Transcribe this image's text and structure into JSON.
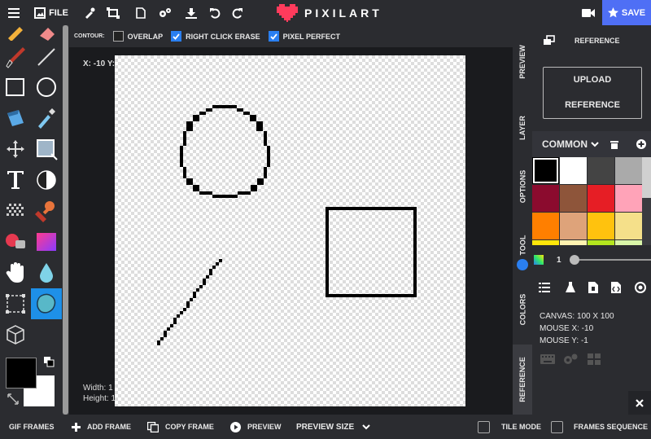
{
  "topbar": {
    "file_label": "FILE",
    "brand_name": "PIXILART",
    "save_label": "SAVE",
    "brand_color": "#ff3b5c",
    "save_color": "#4f6ff5"
  },
  "options": {
    "contour_label": "CONTOUR:",
    "overlap_label": "OVERLAP",
    "overlap_checked": false,
    "right_click_erase_label": "RIGHT CLICK ERASE",
    "right_click_erase_checked": true,
    "pixel_perfect_label": "PIXEL PERFECT",
    "pixel_perfect_checked": true
  },
  "workspace": {
    "coord_readout": "X: -10 Y:",
    "width_label": "Width: 1",
    "height_label": "Height: 1"
  },
  "side_tabs": [
    "PREVIEW",
    "LAYER",
    "OPTIONS",
    "TOOL",
    "COLORS",
    "REFERENCE"
  ],
  "active_side_tab": "REFERENCE",
  "reference": {
    "title": "REFERENCE",
    "upload_line1": "UPLOAD",
    "upload_line2": "REFERENCE"
  },
  "palette": {
    "name": "COMMON",
    "selected": "#000000",
    "swatches": [
      "#000000",
      "#ffffff",
      "#444444",
      "#aaaaaa",
      "#8b0b2e",
      "#8e553a",
      "#e61e25",
      "#ffa3b8",
      "#ff7f00",
      "#dea37a",
      "#ffc20e",
      "#f5e08a",
      "#ffe60a",
      "#fff2b0",
      "#b4e61e",
      "#d9f5a8"
    ]
  },
  "brush": {
    "size": "1"
  },
  "info": {
    "canvas": "CANVAS: 100 X 100",
    "mouse_x": "MOUSE X: -10",
    "mouse_y": "MOUSE Y: -1"
  },
  "colors": {
    "primary": "#000000",
    "secondary": "#ffffff"
  },
  "bottombar": {
    "gif_frames": "GIF FRAMES",
    "add_frame": "ADD FRAME",
    "copy_frame": "COPY FRAME",
    "preview": "PREVIEW",
    "preview_size": "PREVIEW SIZE",
    "tile_mode": "TILE MODE",
    "frames_sequence": "FRAMES SEQUENCE"
  }
}
